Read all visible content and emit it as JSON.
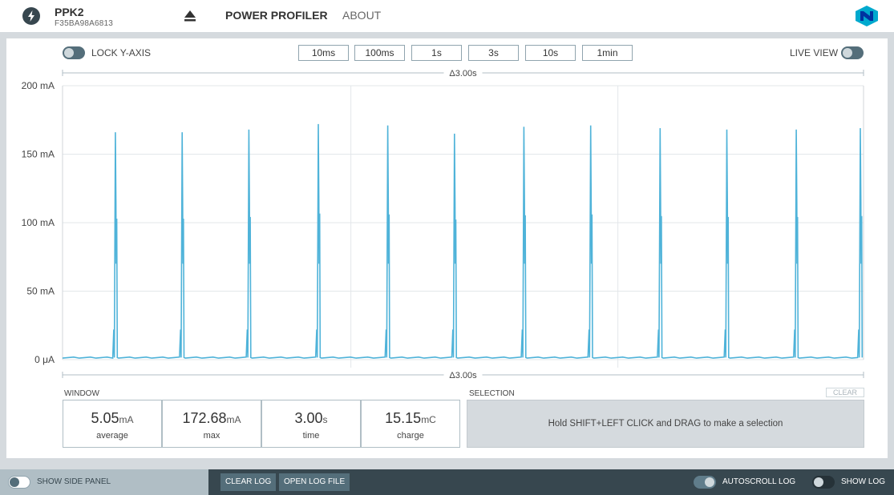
{
  "header": {
    "device_name": "PPK2",
    "device_serial": "F35BA98A6813",
    "nav_power_profiler": "POWER PROFILER",
    "nav_about": "ABOUT"
  },
  "toolbar": {
    "lock_y_axis_label": "LOCK Y-AXIS",
    "lock_y_axis_on": false,
    "live_view_label": "LIVE VIEW",
    "live_view_on": false,
    "window_buttons": [
      "10ms",
      "100ms",
      "1s",
      "3s",
      "10s",
      "1min"
    ]
  },
  "chart_data": {
    "type": "line",
    "delta_top": "Δ3.00s",
    "delta_bottom": "Δ3.00s",
    "y_tick_labels": [
      "200 mA",
      "150 mA",
      "100 mA",
      "50 mA",
      "0 μA"
    ],
    "ylim": [
      0,
      200
    ],
    "xlim": [
      0,
      3.0
    ],
    "x_unit": "s",
    "y_unit": "mA",
    "baseline_mA": 1.5,
    "series_color": "#4fb3d9",
    "pulse_times_s": [
      0.2,
      0.45,
      0.7,
      0.96,
      1.22,
      1.47,
      1.73,
      1.98,
      2.24,
      2.49,
      2.75,
      2.99
    ],
    "pulse_peaks_mA": [
      166,
      166,
      168,
      172,
      171,
      165,
      170,
      171,
      169,
      168,
      168,
      169
    ]
  },
  "stats": {
    "window_label": "WINDOW",
    "selection_label": "SELECTION",
    "clear_label": "CLEAR",
    "selection_hint": "Hold SHIFT+LEFT CLICK and DRAG to make a selection",
    "items": [
      {
        "value": "5.05",
        "unit": "mA",
        "caption": "average"
      },
      {
        "value": "172.68",
        "unit": "mA",
        "caption": "max"
      },
      {
        "value": "3.00",
        "unit": "s",
        "caption": "time"
      },
      {
        "value": "15.15",
        "unit": "mC",
        "caption": "charge"
      }
    ]
  },
  "footer": {
    "show_side_panel": "SHOW SIDE PANEL",
    "clear_log": "CLEAR LOG",
    "open_log_file": "OPEN LOG FILE",
    "autoscroll_log": "AUTOSCROLL LOG",
    "autoscroll_on": true,
    "show_log": "SHOW LOG",
    "show_log_on": false
  }
}
